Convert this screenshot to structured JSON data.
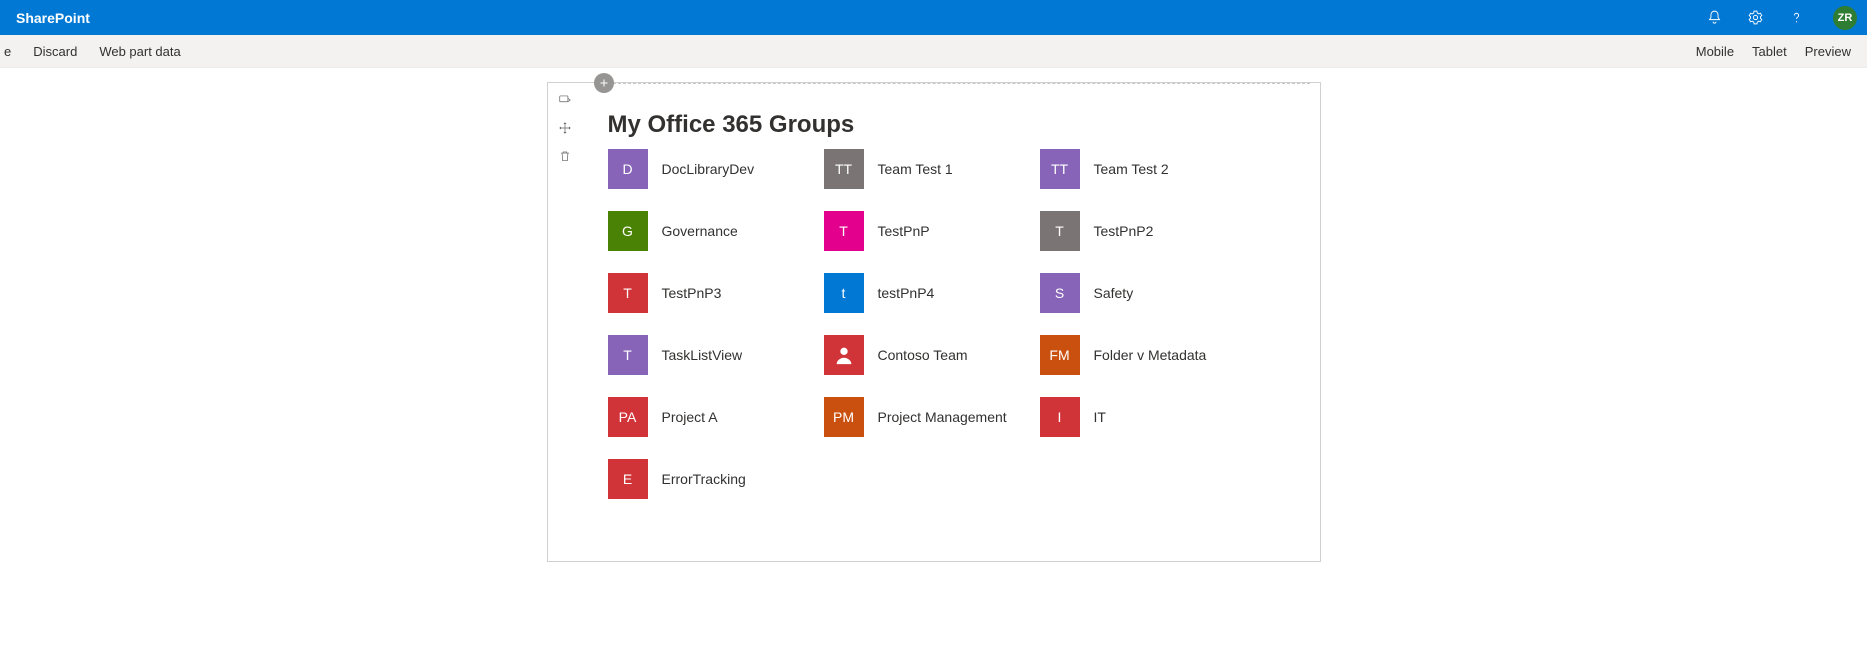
{
  "suite": {
    "appName": "SharePoint",
    "avatar": "ZR"
  },
  "commandBar": {
    "truncated": "e",
    "left": [
      "Discard",
      "Web part data"
    ],
    "right": [
      "Mobile",
      "Tablet",
      "Preview"
    ]
  },
  "webpart": {
    "title": "My Office 365 Groups",
    "groups": [
      {
        "initials": "D",
        "label": "DocLibraryDev",
        "color": "#8764b8"
      },
      {
        "initials": "TT",
        "label": "Team Test 1",
        "color": "#7a7574"
      },
      {
        "initials": "TT",
        "label": "Team Test 2",
        "color": "#8764b8"
      },
      {
        "initials": "G",
        "label": "Governance",
        "color": "#498205"
      },
      {
        "initials": "T",
        "label": "TestPnP",
        "color": "#e3008c"
      },
      {
        "initials": "T",
        "label": "TestPnP2",
        "color": "#7a7574"
      },
      {
        "initials": "T",
        "label": "TestPnP3",
        "color": "#d13438"
      },
      {
        "initials": "t",
        "label": "testPnP4",
        "color": "#0078d4"
      },
      {
        "initials": "S",
        "label": "Safety",
        "color": "#8764b8"
      },
      {
        "initials": "T",
        "label": "TaskListView",
        "color": "#8764b8"
      },
      {
        "initials": "",
        "label": "Contoso Team",
        "color": "#d13438",
        "persona": true
      },
      {
        "initials": "FM",
        "label": "Folder v Metadata",
        "color": "#ca5010"
      },
      {
        "initials": "PA",
        "label": "Project A",
        "color": "#d13438"
      },
      {
        "initials": "PM",
        "label": "Project Management",
        "color": "#ca5010"
      },
      {
        "initials": "I",
        "label": "IT",
        "color": "#d13438"
      },
      {
        "initials": "E",
        "label": "ErrorTracking",
        "color": "#d13438"
      }
    ]
  }
}
